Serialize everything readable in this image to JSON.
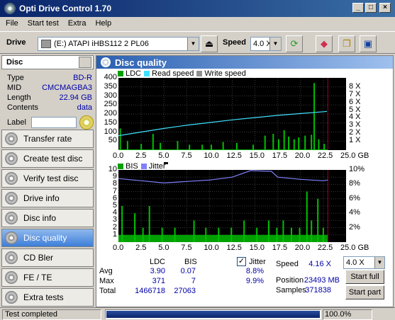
{
  "window": {
    "title": "Opti Drive Control 1.70"
  },
  "menu": [
    "File",
    "Start test",
    "Extra",
    "Help"
  ],
  "toolbar": {
    "drive_label": "Drive",
    "drive_value": "(E:)   ATAPI iHBS112   2 PL06",
    "speed_label": "Speed",
    "speed_value": "4.0 X"
  },
  "disc": {
    "header": "Disc",
    "type_label": "Type",
    "type_value": "BD-R",
    "mid_label": "MID",
    "mid_value": "CMCMAGBA3",
    "length_label": "Length",
    "length_value": "22.94 GB",
    "contents_label": "Contents",
    "contents_value": "data",
    "label_label": "Label"
  },
  "nav": [
    {
      "label": "Transfer rate"
    },
    {
      "label": "Create test disc"
    },
    {
      "label": "Verify test disc"
    },
    {
      "label": "Drive info"
    },
    {
      "label": "Disc info"
    },
    {
      "label": "Disc quality"
    },
    {
      "label": "CD Bler"
    },
    {
      "label": "FE / TE"
    },
    {
      "label": "Extra tests"
    }
  ],
  "panel": {
    "title": "Disc quality"
  },
  "chart_data": [
    {
      "type": "bar",
      "legend": [
        {
          "name": "LDC",
          "color": "#00a000"
        },
        {
          "name": "Read speed",
          "color": "#40e0ff"
        },
        {
          "name": "Write speed",
          "color": "#909090"
        }
      ],
      "x_ticks": [
        "0.0",
        "2.5",
        "5.0",
        "7.5",
        "10.0",
        "12.5",
        "15.0",
        "17.5",
        "20.0",
        "22.5",
        "25.0 GB"
      ],
      "y_left_ticks": [
        "400",
        "350",
        "300",
        "250",
        "200",
        "150",
        "100",
        "50"
      ],
      "y_right_ticks": [
        "8 X",
        "7 X",
        "6 X",
        "5 X",
        "4 X",
        "3 X",
        "2 X",
        "1 X"
      ],
      "xlim": [
        0,
        25
      ],
      "ylim": [
        0,
        400
      ],
      "y2lim": [
        0,
        8
      ],
      "ldc_spikes": [
        {
          "x": 0.2,
          "y": 120
        },
        {
          "x": 1.0,
          "y": 50
        },
        {
          "x": 2.5,
          "y": 35
        },
        {
          "x": 3.8,
          "y": 90
        },
        {
          "x": 4.6,
          "y": 40
        },
        {
          "x": 6.5,
          "y": 50
        },
        {
          "x": 7.8,
          "y": 30
        },
        {
          "x": 9.2,
          "y": 30
        },
        {
          "x": 10.2,
          "y": 30
        },
        {
          "x": 11.5,
          "y": 45
        },
        {
          "x": 13.0,
          "y": 40
        },
        {
          "x": 14.8,
          "y": 30
        },
        {
          "x": 16.1,
          "y": 80
        },
        {
          "x": 17.0,
          "y": 90
        },
        {
          "x": 17.6,
          "y": 60
        },
        {
          "x": 18.2,
          "y": 110
        },
        {
          "x": 18.7,
          "y": 75
        },
        {
          "x": 19.3,
          "y": 60
        },
        {
          "x": 19.8,
          "y": 70
        },
        {
          "x": 20.5,
          "y": 80
        },
        {
          "x": 21.2,
          "y": 85
        },
        {
          "x": 21.5,
          "y": 371
        },
        {
          "x": 22.0,
          "y": 60
        },
        {
          "x": 22.6,
          "y": 35
        }
      ],
      "ldc_baseline": 4,
      "read_speed": [
        [
          0,
          1.6
        ],
        [
          2.5,
          2.0
        ],
        [
          5,
          2.4
        ],
        [
          7.5,
          2.75
        ],
        [
          10,
          3.05
        ],
        [
          12.5,
          3.35
        ],
        [
          15,
          3.6
        ],
        [
          17.5,
          3.85
        ],
        [
          20,
          4.05
        ],
        [
          22.5,
          4.25
        ],
        [
          22.9,
          4.28
        ]
      ],
      "end_marker_x": 23.0
    },
    {
      "type": "bar",
      "legend": [
        {
          "name": "BIS",
          "color": "#00a000"
        },
        {
          "name": "Jitter",
          "color": "#8080ff"
        }
      ],
      "x_ticks": [
        "0.0",
        "2.5",
        "5.0",
        "7.5",
        "10.0",
        "12.5",
        "15.0",
        "17.5",
        "20.0",
        "22.5",
        "25.0 GB"
      ],
      "y_left_ticks": [
        "10",
        "9",
        "8",
        "7",
        "6",
        "5",
        "4",
        "3",
        "2",
        "1"
      ],
      "y_right_ticks": [
        "10%",
        "8%",
        "6%",
        "4%",
        "2%"
      ],
      "xlim": [
        0,
        25
      ],
      "ylim": [
        0,
        10
      ],
      "y2lim": [
        0,
        10
      ],
      "bis_bars": [
        {
          "x": 0.4,
          "y": 5
        },
        {
          "x": 1.8,
          "y": 4
        },
        {
          "x": 2.7,
          "y": 2
        },
        {
          "x": 3.4,
          "y": 5
        },
        {
          "x": 4.8,
          "y": 2
        },
        {
          "x": 6.2,
          "y": 2
        },
        {
          "x": 8.3,
          "y": 3
        },
        {
          "x": 9.6,
          "y": 2
        },
        {
          "x": 11.0,
          "y": 2
        },
        {
          "x": 12.4,
          "y": 2
        },
        {
          "x": 13.8,
          "y": 3
        },
        {
          "x": 15.2,
          "y": 2
        },
        {
          "x": 16.5,
          "y": 3
        },
        {
          "x": 17.4,
          "y": 2
        },
        {
          "x": 18.1,
          "y": 3
        },
        {
          "x": 19.0,
          "y": 2
        },
        {
          "x": 19.9,
          "y": 2
        },
        {
          "x": 20.7,
          "y": 7
        },
        {
          "x": 21.2,
          "y": 3
        },
        {
          "x": 21.9,
          "y": 6
        },
        {
          "x": 22.5,
          "y": 2
        }
      ],
      "bis_baseline": 1,
      "jitter": [
        [
          0,
          8.8
        ],
        [
          2.5,
          8.5
        ],
        [
          5,
          8.2
        ],
        [
          7.5,
          8.4
        ],
        [
          10,
          8.6
        ],
        [
          12.5,
          9.0
        ],
        [
          14.5,
          9.9
        ],
        [
          16.8,
          9.8
        ],
        [
          17.5,
          9.0
        ],
        [
          20,
          8.7
        ],
        [
          22.5,
          8.5
        ],
        [
          23,
          8.6
        ]
      ],
      "end_marker_x": 23.0
    }
  ],
  "stats": {
    "col_ldc": "LDC",
    "col_bis": "BIS",
    "avg_label": "Avg",
    "avg_ldc": "3.90",
    "avg_bis": "0.07",
    "max_label": "Max",
    "max_ldc": "371",
    "max_bis": "7",
    "total_label": "Total",
    "total_ldc": "1466718",
    "total_bis": "27063",
    "jitter_label": "Jitter",
    "jitter_avg": "8.8%",
    "jitter_max": "9.9%",
    "speed_label": "Speed",
    "speed_value": "4.16 X",
    "position_label": "Position",
    "position_value": "23493 MB",
    "samples_label": "Samples",
    "samples_value": "371838",
    "speed_select": "4.0 X",
    "start_full": "Start full",
    "start_part": "Start part"
  },
  "status": {
    "text": "Test completed",
    "percent": "100.0%",
    "progress": 1.0
  }
}
